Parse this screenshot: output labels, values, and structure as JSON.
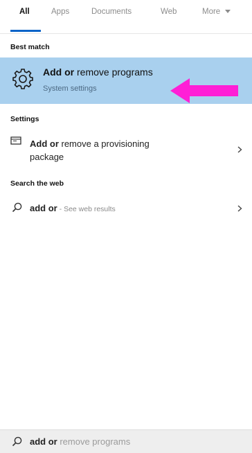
{
  "tabs": [
    {
      "label": "All"
    },
    {
      "label": "Apps"
    },
    {
      "label": "Documents"
    },
    {
      "label": "Web"
    },
    {
      "label": "More"
    }
  ],
  "best_match": {
    "heading": "Best match",
    "title_bold": "Add or",
    "title_rest": " remove programs",
    "subtitle": "System settings"
  },
  "settings": {
    "heading": "Settings",
    "item_bold": "Add or",
    "item_line1_rest": " remove a provisioning",
    "item_line2": "package"
  },
  "web": {
    "heading": "Search the web",
    "query_bold": "add or",
    "query_suffix": " - See web results"
  },
  "search_box": {
    "typed": "add or",
    "suggestion": " remove programs"
  },
  "colors": {
    "accent": "#0a64c8",
    "highlight": "#a9d0ee",
    "pointer_arrow": "#ff1fd6"
  }
}
